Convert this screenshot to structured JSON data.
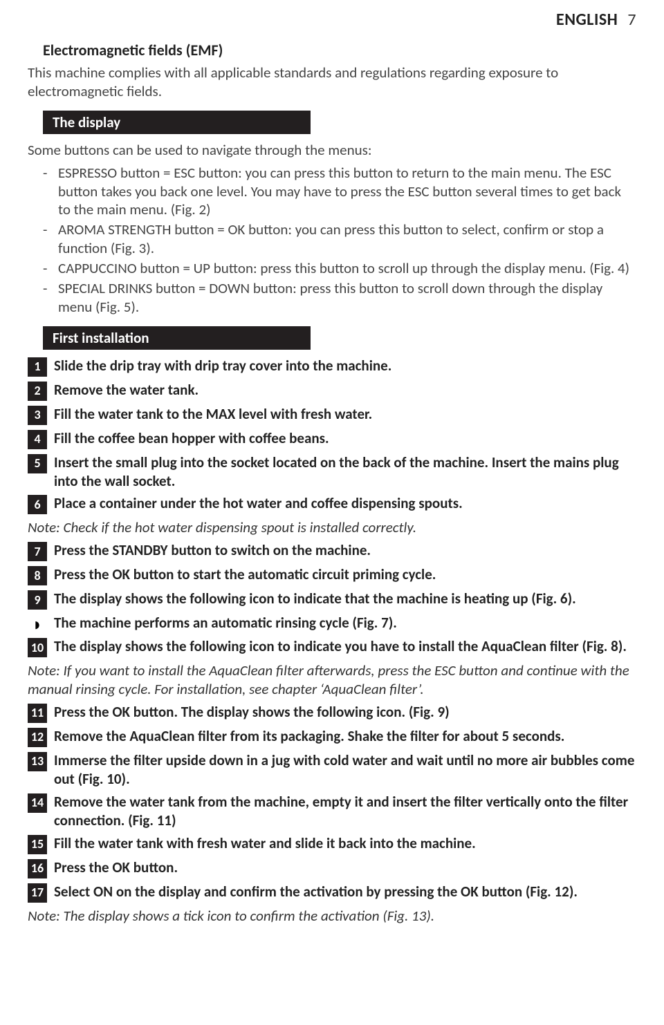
{
  "header": {
    "language": "ENGLISH",
    "page_number": "7"
  },
  "emf": {
    "heading": "Electromagnetic fields (EMF)",
    "body": "This machine complies with all applicable standards and regulations regarding exposure to electromagnetic fields."
  },
  "display": {
    "bar": "The display",
    "intro": "Some buttons can be used to navigate through the menus:",
    "items": [
      "ESPRESSO button = ESC button: you can press this button to return to the main menu. The ESC button takes you back one level. You may have to press the ESC button several times to get back to the main menu.  (Fig. 2)",
      "AROMA STRENGTH button = OK button: you can press this button to select, confirm or stop a function (Fig. 3).",
      "CAPPUCCINO button = UP button: press this button to scroll up through the display menu.  (Fig. 4)",
      "SPECIAL DRINKS button = DOWN button: press this button to scroll down through the display menu (Fig. 5)."
    ]
  },
  "first_install": {
    "bar": "First installation",
    "steps": [
      {
        "n": "1",
        "text": "Slide the drip tray with drip tray cover into the machine."
      },
      {
        "n": "2",
        "text": "Remove the water tank."
      },
      {
        "n": "3",
        "text": "Fill the water tank to the MAX level with fresh water."
      },
      {
        "n": "4",
        "text": "Fill the coffee bean hopper with coffee beans."
      },
      {
        "n": "5",
        "text": "Insert the small plug into the socket located on the back of the machine. Insert the mains plug into the wall socket."
      },
      {
        "n": "6",
        "text": "Place a container under the hot water and coffee dispensing spouts."
      }
    ],
    "note1": "Note: Check if the hot water dispensing spout is installed correctly.",
    "steps2": [
      {
        "n": "7",
        "text": "Press the STANDBY button to switch on the machine."
      },
      {
        "n": "8",
        "text": "Press the OK button to start the automatic circuit priming cycle."
      },
      {
        "n": "9",
        "text": "The display shows the following icon to indicate that the machine is heating up (Fig. 6)."
      }
    ],
    "sub9": "The machine performs an automatic rinsing cycle (Fig. 7).",
    "steps3": [
      {
        "n": "10",
        "text": "The display shows the following icon to indicate you have to install the AquaClean filter (Fig. 8)."
      }
    ],
    "note2": "Note: If you want to install the AquaClean filter afterwards, press the ESC button and continue with the manual rinsing cycle. For installation, see chapter ‘AquaClean filter’.",
    "steps4": [
      {
        "n": "11",
        "text": "Press the OK button. The display shows the following icon.  (Fig. 9)"
      },
      {
        "n": "12",
        "text": "Remove the AquaClean filter from its packaging. Shake the filter for about 5 seconds."
      },
      {
        "n": "13",
        "text": "Immerse the filter upside down in a jug with cold water and wait until no more air bubbles come out (Fig. 10)."
      },
      {
        "n": "14",
        "text": "Remove the water tank from the machine, empty it and insert the filter vertically onto the filter connection.  (Fig. 11)"
      },
      {
        "n": "15",
        "text": "Fill the water tank with fresh water and slide it back into the machine."
      },
      {
        "n": "16",
        "text": "Press the OK button."
      },
      {
        "n": "17",
        "text": "Select ON on the display and confirm the activation by pressing the OK button (Fig. 12)."
      }
    ],
    "note3": "Note: The display shows a tick icon to confirm the activation (Fig. 13)."
  }
}
